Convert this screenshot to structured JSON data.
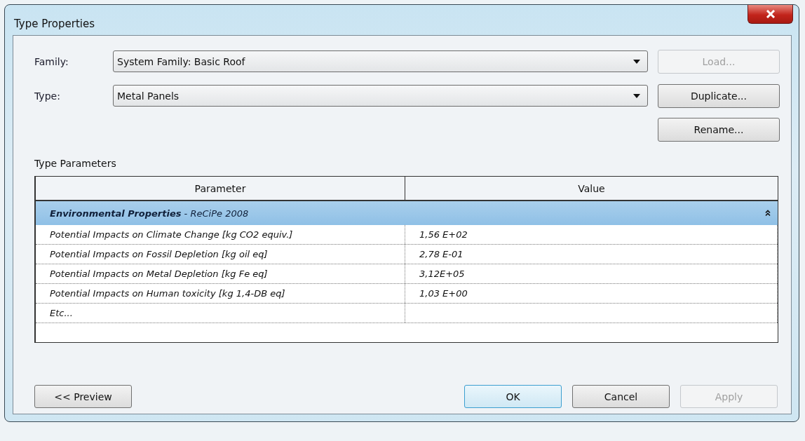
{
  "window": {
    "title": "Type Properties"
  },
  "selectors": [
    {
      "label": "Family:",
      "value": "System Family: Basic Roof",
      "button": {
        "label": "Load...",
        "disabled": true
      }
    },
    {
      "label": "Type:",
      "value": "Metal Panels",
      "button": {
        "label": "Duplicate...",
        "disabled": false
      }
    },
    {
      "button": {
        "label": "Rename...",
        "disabled": false
      }
    }
  ],
  "section_label": "Type Parameters",
  "table": {
    "columns": [
      "Parameter",
      "Value"
    ],
    "groups": [
      {
        "name": "Environmental Properties",
        "subtitle": " - ReCiPe 2008",
        "expanded": true,
        "rows": [
          {
            "parameter": "Potential Impacts on Climate Change [kg CO2 equiv.]",
            "value": "1,56 E+02"
          },
          {
            "parameter": "Potential Impacts on Fossil Depletion [kg oil eq]",
            "value": "2,78 E-01"
          },
          {
            "parameter": "Potential Impacts on Metal Depletion [kg Fe eq]",
            "value": "3,12E+05"
          },
          {
            "parameter": "Potential Impacts on Human toxicity [kg 1,4-DB eq]",
            "value": "1,03 E+00"
          },
          {
            "parameter": "Etc..."
          }
        ]
      }
    ]
  },
  "footer": {
    "left": [
      {
        "label": "<< Preview",
        "disabled": false,
        "default": false
      }
    ],
    "right": [
      {
        "label": "OK",
        "disabled": false,
        "default": true
      },
      {
        "label": "Cancel",
        "disabled": false,
        "default": false
      },
      {
        "label": "Apply",
        "disabled": true,
        "default": false
      }
    ]
  }
}
